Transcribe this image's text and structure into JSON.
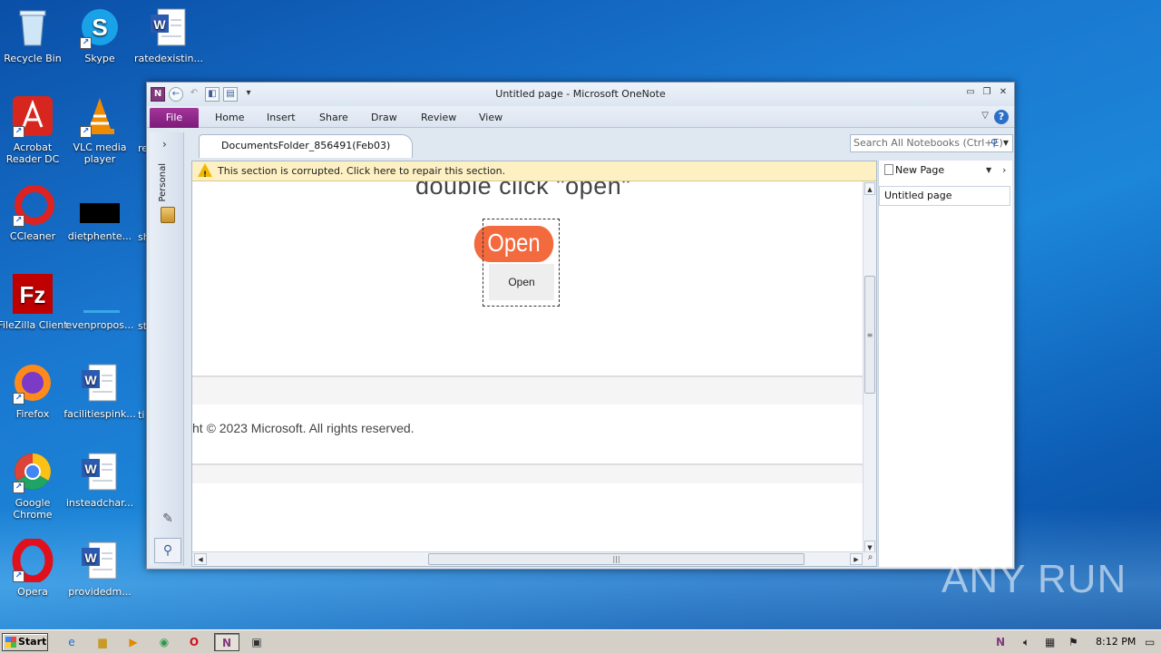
{
  "desktop": {
    "icons": [
      {
        "label": "Recycle Bin",
        "icon": "recycle-bin-icon"
      },
      {
        "label": "Skype",
        "icon": "skype-icon"
      },
      {
        "label": "ratedexistin...",
        "icon": "word-doc-icon"
      },
      {
        "label": "Acrobat Reader DC",
        "icon": "acrobat-icon"
      },
      {
        "label": "VLC media player",
        "icon": "vlc-icon"
      },
      {
        "label": "CCleaner",
        "icon": "ccleaner-icon"
      },
      {
        "label": "dietphente...",
        "icon": "black-file-icon"
      },
      {
        "label": "FileZilla Client",
        "icon": "filezilla-icon"
      },
      {
        "label": "evenpropos...",
        "icon": "blank-file-icon"
      },
      {
        "label": "Firefox",
        "icon": "firefox-icon"
      },
      {
        "label": "facilitiespink...",
        "icon": "word-doc-icon"
      },
      {
        "label": "Google Chrome",
        "icon": "chrome-icon"
      },
      {
        "label": "insteadchar...",
        "icon": "word-doc-icon"
      },
      {
        "label": "Opera",
        "icon": "opera-icon"
      },
      {
        "label": "providedm...",
        "icon": "word-doc-icon"
      }
    ],
    "partial_labels": [
      "re",
      "sh",
      "st",
      "ti"
    ]
  },
  "window": {
    "title": "Untitled page  -  Microsoft OneNote",
    "file_tab": "File",
    "tabs": [
      "Home",
      "Insert",
      "Share",
      "Draw",
      "Review",
      "View"
    ],
    "notebook_label": "Personal",
    "section_tab": "DocumentsFolder_856491(Feb03)",
    "search_placeholder": "Search All Notebooks (Ctrl+E)",
    "warning": "This section is corrupted. Click here to repair this section.",
    "page": {
      "heading": "double click \"open\"",
      "open_big": "Open",
      "open_small": "Open",
      "copyright": "ht © 2023 Microsoft. All rights reserved."
    },
    "pagelist": {
      "new_page": "New Page",
      "pages": [
        "Untitled page"
      ]
    }
  },
  "watermark": "ANY  RUN",
  "taskbar": {
    "start": "Start",
    "clock": "8:12 PM"
  },
  "colors": {
    "onenote_purple": "#80397b",
    "open_button": "#f26a3d",
    "warning_bg": "#fdf0c3"
  }
}
